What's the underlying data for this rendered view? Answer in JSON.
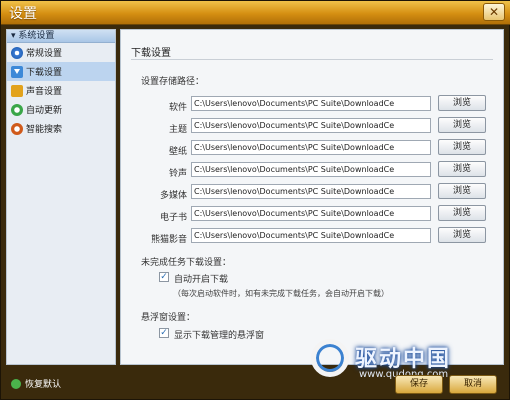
{
  "window": {
    "title": "设置",
    "close_label": "✕"
  },
  "sidebar": {
    "header": "▾ 系统设置",
    "items": [
      {
        "label": "常规设置",
        "icon": "gear-icon"
      },
      {
        "label": "下载设置",
        "icon": "download-icon",
        "active": true
      },
      {
        "label": "声音设置",
        "icon": "sound-icon"
      },
      {
        "label": "自动更新",
        "icon": "refresh-icon"
      },
      {
        "label": "智能搜索",
        "icon": "search-icon"
      }
    ]
  },
  "main": {
    "section_title": "下载设置",
    "storage_label": "设置存储路径：",
    "browse_label": "浏览",
    "paths": [
      {
        "label": "软件",
        "value": "C:\\Users\\lenovo\\Documents\\PC Suite\\DownloadCe"
      },
      {
        "label": "主题",
        "value": "C:\\Users\\lenovo\\Documents\\PC Suite\\DownloadCe"
      },
      {
        "label": "壁纸",
        "value": "C:\\Users\\lenovo\\Documents\\PC Suite\\DownloadCe"
      },
      {
        "label": "铃声",
        "value": "C:\\Users\\lenovo\\Documents\\PC Suite\\DownloadCe"
      },
      {
        "label": "多媒体",
        "value": "C:\\Users\\lenovo\\Documents\\PC Suite\\DownloadCe"
      },
      {
        "label": "电子书",
        "value": "C:\\Users\\lenovo\\Documents\\PC Suite\\DownloadCe"
      },
      {
        "label": "熊猫影音",
        "value": "C:\\Users\\lenovo\\Documents\\PC Suite\\DownloadCe"
      }
    ],
    "unfinished_label": "未完成任务下载设置：",
    "auto_start_label": "自动开启下载",
    "auto_start_checked": true,
    "auto_start_note": "（每次启动软件时，如有未完成下载任务，会自动开启下载）",
    "float_label": "悬浮窗设置：",
    "float_show_label": "显示下载管理的悬浮窗",
    "float_show_checked": true
  },
  "footer": {
    "restore_label": "恢复默认",
    "save_label": "保存",
    "cancel_label": "取消"
  },
  "watermark": {
    "text": "驱动中国",
    "url": "www.qudong.com"
  },
  "colors": {
    "title_bar": "#d58f12",
    "accent": "#3c82d0",
    "checkmark": "#2a6db3"
  }
}
